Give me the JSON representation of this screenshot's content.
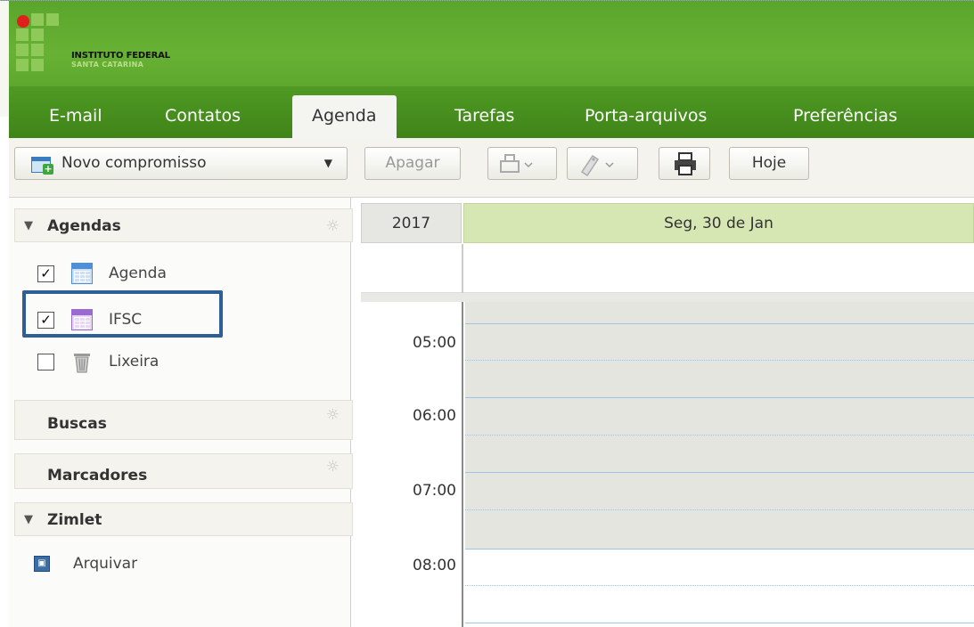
{
  "brand": {
    "line1": "INSTITUTO FEDERAL",
    "line2": "SANTA CATARINA",
    "colors": {
      "header": "#5ea82e",
      "tabbar": "#47901e",
      "accent_red": "#e0201b"
    }
  },
  "tabs": [
    {
      "label": "E-mail",
      "active": false
    },
    {
      "label": "Contatos",
      "active": false
    },
    {
      "label": "Agenda",
      "active": true
    },
    {
      "label": "Tarefas",
      "active": false
    },
    {
      "label": "Porta-arquivos",
      "active": false
    },
    {
      "label": "Preferências",
      "active": false
    }
  ],
  "toolbar": {
    "new_appointment": "Novo compromisso",
    "delete": "Apagar",
    "today": "Hoje",
    "icons": [
      "calendar-add-icon",
      "move-icon",
      "tag-icon",
      "print-icon"
    ]
  },
  "sidebar": {
    "agendas_header": "Agendas",
    "agendas": [
      {
        "label": "Agenda",
        "checked": true,
        "color": "#4f8fd8",
        "icon": "calendar-icon"
      },
      {
        "label": "IFSC",
        "checked": true,
        "color": "#9a6ad0",
        "icon": "calendar-icon"
      },
      {
        "label": "Lixeira",
        "checked": false,
        "icon": "trash-icon"
      }
    ],
    "searches_header": "Buscas",
    "tags_header": "Marcadores",
    "zimlet_header": "Zimlet",
    "zimlet_items": [
      {
        "label": "Arquivar",
        "icon": "archive-icon"
      }
    ]
  },
  "calendar": {
    "year": "2017",
    "day": "Seg, 30 de Jan",
    "times": [
      "05:00",
      "06:00",
      "07:00",
      "08:00"
    ]
  }
}
